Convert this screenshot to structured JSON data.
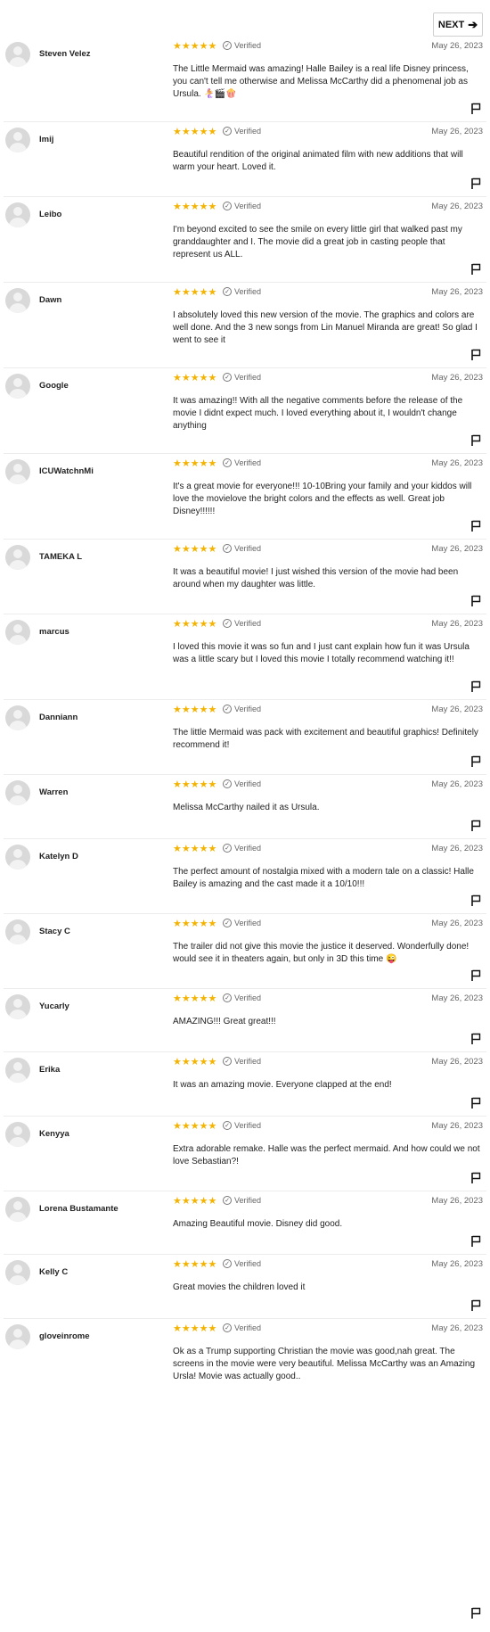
{
  "pagination": {
    "next_label": "NEXT"
  },
  "verified_label": "Verified",
  "star_glyph": "★",
  "star_color": "#f5b301",
  "reviews": [
    {
      "author": "Steven Velez",
      "rating": 5,
      "date": "May 26, 2023",
      "text": "The Little Mermaid was amazing! Halle Bailey is a real life Disney princess, you can't tell me otherwise and Melissa McCarthy did a phenomenal job as Ursula. 🧜‍♀️🎬🍿"
    },
    {
      "author": "Imij",
      "rating": 5,
      "date": "May 26, 2023",
      "text": "Beautiful rendition of the original animated film with new additions that will warm your heart. Loved it."
    },
    {
      "author": "Leibo",
      "rating": 5,
      "date": "May 26, 2023",
      "text": "I'm beyond excited to see the smile on every little girl that walked past my granddaughter and I. The movie did a great job in casting people that represent us ALL."
    },
    {
      "author": "Dawn",
      "rating": 5,
      "date": "May 26, 2023",
      "text": "I absolutely loved this new version of the movie. The graphics and colors are well done. And the 3 new songs from Lin Manuel Miranda are great! So glad I went to see it"
    },
    {
      "author": "Google",
      "rating": 5,
      "date": "May 26, 2023",
      "text": "It was amazing!! With all the negative comments before the release of the movie I didnt expect much. I loved everything about it, I wouldn't change anything"
    },
    {
      "author": "ICUWatchnMi",
      "rating": 5,
      "date": "May 26, 2023",
      "text": "It's a great movie for everyone!!! 10-10Bring your family and your kiddos will love the movielove the bright colors and the effects as well. Great job Disney!!!!!!"
    },
    {
      "author": "TAMEKA L",
      "rating": 5,
      "date": "May 26, 2023",
      "text": "It was a beautiful movie! I just wished this version of the movie had been around when my daughter was little."
    },
    {
      "author": "marcus",
      "rating": 5,
      "date": "May 26, 2023",
      "text": "I loved this movie it was so fun and I just cant explain how fun it was Ursula was a little scary but I loved this movie I totally recommend watching it!!"
    },
    {
      "author": "Danniann",
      "rating": 5,
      "date": "May 26, 2023",
      "text": "The little Mermaid was pack with excitement and beautiful graphics! Definitely recommend it!"
    },
    {
      "author": "Warren",
      "rating": 5,
      "date": "May 26, 2023",
      "text": "Melissa McCarthy nailed it as Ursula."
    },
    {
      "author": "Katelyn D",
      "rating": 5,
      "date": "May 26, 2023",
      "text": "The perfect amount of nostalgia mixed with a modern tale on a classic! Halle Bailey is amazing and the cast made it a 10/10!!!"
    },
    {
      "author": "Stacy C",
      "rating": 5,
      "date": "May 26, 2023",
      "text": "The trailer did not give this movie the justice it deserved. Wonderfully done! would see it in theaters again, but only in 3D this time 😜"
    },
    {
      "author": "Yucarly",
      "rating": 5,
      "date": "May 26, 2023",
      "text": "AMAZING!!! Great great!!!"
    },
    {
      "author": "Erika",
      "rating": 5,
      "date": "May 26, 2023",
      "text": "It was an amazing movie. Everyone clapped at the end!"
    },
    {
      "author": "Kenyya",
      "rating": 5,
      "date": "May 26, 2023",
      "text": "Extra adorable remake. Halle was the perfect mermaid. And how could we not love Sebastian?!"
    },
    {
      "author": "Lorena Bustamante",
      "rating": 5,
      "date": "May 26, 2023",
      "text": "Amazing Beautiful movie. Disney did good."
    },
    {
      "author": "Kelly C",
      "rating": 5,
      "date": "May 26, 2023",
      "text": "Great movies the children loved it"
    },
    {
      "author": "gloveinrome",
      "rating": 5,
      "date": "May 26, 2023",
      "text": "Ok as a Trump supporting Christian the movie was good,nah great. The screens in the movie were very beautiful. Melissa McCarthy was an Amazing Ursla! Movie was actually good.."
    }
  ]
}
